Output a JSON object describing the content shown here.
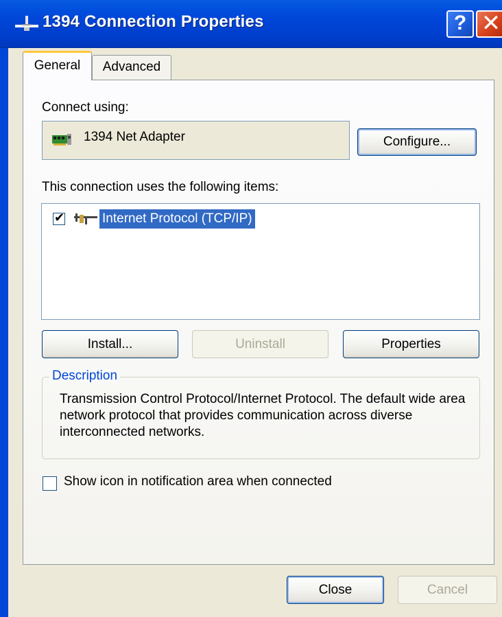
{
  "window": {
    "title": "1394 Connection Properties",
    "help_label": "?",
    "close_label": "✕"
  },
  "tabs": [
    {
      "label": "General",
      "selected": true
    },
    {
      "label": "Advanced",
      "selected": false
    }
  ],
  "general": {
    "connect_using_label": "Connect using:",
    "adapter_name": "1394 Net Adapter",
    "configure_label": "Configure...",
    "items_label": "This connection uses the following items:",
    "items": [
      {
        "label": "Internet Protocol (TCP/IP)",
        "checked": true,
        "selected": true
      }
    ],
    "install_label": "Install...",
    "uninstall_label": "Uninstall",
    "properties_label": "Properties",
    "description_title": "Description",
    "description_text": "Transmission Control Protocol/Internet Protocol. The default wide area network protocol that provides communication across diverse interconnected networks.",
    "show_icon_label": "Show icon in notification area when connected",
    "show_icon_checked": false
  },
  "footer": {
    "close_label": "Close",
    "cancel_label": "Cancel"
  },
  "colors": {
    "titlebar": "#0046D8",
    "selection": "#316AC5",
    "group_title": "#0046D5",
    "dialog_bg": "#ECE9D8"
  }
}
